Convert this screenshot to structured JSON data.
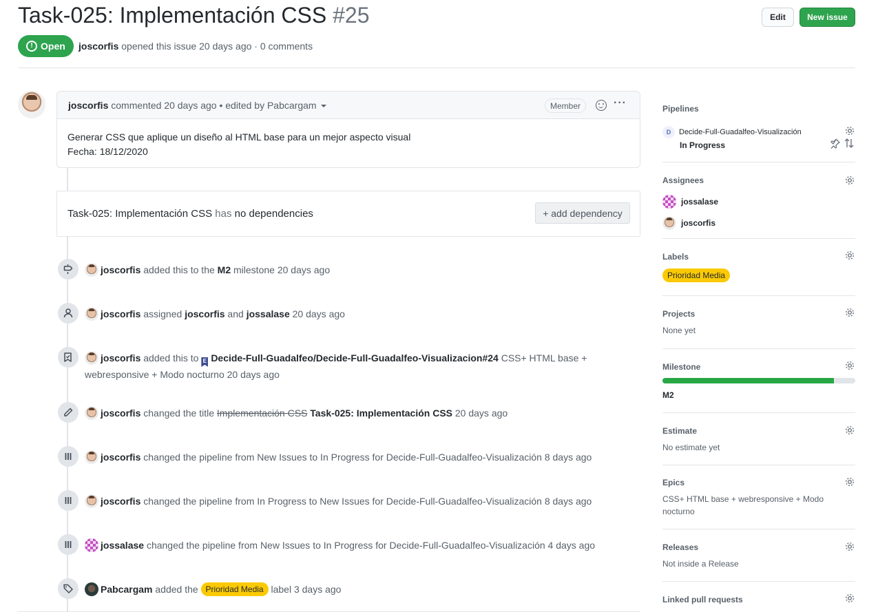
{
  "header": {
    "title": "Task-025: Implementación CSS",
    "number": "#25",
    "edit_label": "Edit",
    "new_issue_label": "New issue",
    "state": "Open",
    "author": "joscorfis",
    "meta_rest": " opened this issue 20 days ago · 0 comments"
  },
  "comment": {
    "author": "joscorfis",
    "meta": " commented 20 days ago • edited by Pabcargam",
    "badge": "Member",
    "body_line1": "Generar CSS que aplique un diseño al HTML base para un mejor aspecto visual",
    "body_line2": "Fecha: 18/12/2020"
  },
  "dependencies": {
    "title": "Task-025: Implementación CSS",
    "has": "has",
    "rest": "no dependencies",
    "button": "+ add dependency"
  },
  "events": [
    {
      "actor": "joscorfis",
      "t1": " added this to the ",
      "b1": "M2",
      "t2": " milestone 20 days ago"
    },
    {
      "actor": "joscorfis",
      "t1": " assigned ",
      "b1": "joscorfis",
      "t2": " and ",
      "b2": "jossalase",
      "t3": " 20 days ago"
    },
    {
      "actor": "joscorfis",
      "t1": " added this to ",
      "flag": "E",
      "b1": "Decide-Full-Guadalfeo/Decide-Full-Guadalfeo-Visualizacion#24",
      "t2": " CSS+ HTML base + webresponsive + Modo nocturno 20 days ago"
    },
    {
      "actor": "joscorfis",
      "t1": " changed the title ",
      "strike": "Implementación CSS",
      "b1": "Task-025: Implementación CSS",
      "t2": " 20 days ago"
    },
    {
      "actor": "joscorfis",
      "t1": " changed the pipeline from New Issues to In Progress for Decide-Full-Guadalfeo-Visualización 8 days ago"
    },
    {
      "actor": "joscorfis",
      "t1": " changed the pipeline from In Progress to New Issues for Decide-Full-Guadalfeo-Visualización 8 days ago"
    },
    {
      "actor": "jossalase",
      "t1": " changed the pipeline from New Issues to In Progress for Decide-Full-Guadalfeo-Visualización 4 days ago"
    },
    {
      "actor": "Pabcargam",
      "t1": " added the ",
      "label": "Prioridad Media",
      "t2": " label 3 days ago"
    }
  ],
  "sidebar": {
    "pipelines": {
      "title": "Pipelines",
      "badge": "D",
      "repo": "Decide-Full-Guadalfeo-Visualización",
      "status": "In Progress"
    },
    "assignees": {
      "title": "Assignees",
      "users": [
        "jossalase",
        "joscorfis"
      ]
    },
    "labels": {
      "title": "Labels",
      "label": "Prioridad Media"
    },
    "projects": {
      "title": "Projects",
      "value": "None yet"
    },
    "milestone": {
      "title": "Milestone",
      "name": "M2",
      "progress": 0.89
    },
    "estimate": {
      "title": "Estimate",
      "value": "No estimate yet"
    },
    "epics": {
      "title": "Epics",
      "value": "CSS+ HTML base + webresponsive + Modo nocturno"
    },
    "releases": {
      "title": "Releases",
      "value": "Not inside a Release"
    },
    "linked_prs": {
      "title": "Linked pull requests"
    }
  },
  "colors": {
    "open_green": "#2ea44f",
    "label_yellow": "#fbca04",
    "progress_green": "#28a745"
  }
}
